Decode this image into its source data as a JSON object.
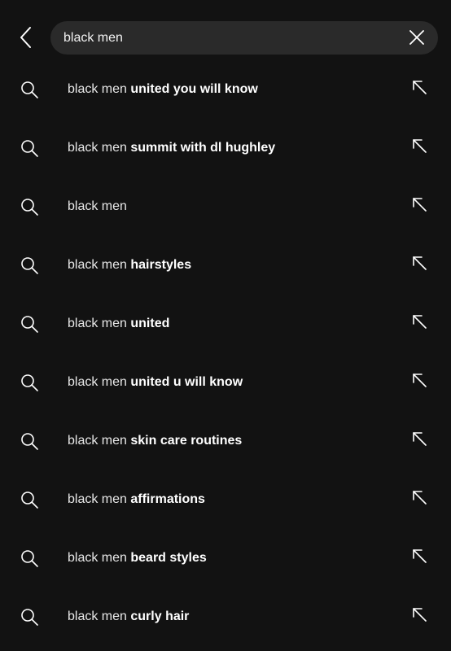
{
  "search": {
    "value": "black men",
    "prefix": "black men"
  },
  "suggestions": [
    {
      "prefix": "black men",
      "suffix": "united you will know"
    },
    {
      "prefix": "black men",
      "suffix": "summit with dl hughley"
    },
    {
      "prefix": "black men",
      "suffix": ""
    },
    {
      "prefix": "black men",
      "suffix": "hairstyles"
    },
    {
      "prefix": "black men",
      "suffix": "united"
    },
    {
      "prefix": "black men",
      "suffix": "united u will know"
    },
    {
      "prefix": "black men",
      "suffix": "skin care routines"
    },
    {
      "prefix": "black men",
      "suffix": "affirmations"
    },
    {
      "prefix": "black men",
      "suffix": "beard styles"
    },
    {
      "prefix": "black men",
      "suffix": "curly hair"
    }
  ],
  "icons": {
    "back": "chevron-left-icon",
    "clear": "close-icon",
    "search": "search-icon",
    "fill": "arrow-up-left-icon"
  },
  "colors": {
    "background": "#121212",
    "search_box": "#2a2a2a",
    "text": "#ffffff"
  }
}
